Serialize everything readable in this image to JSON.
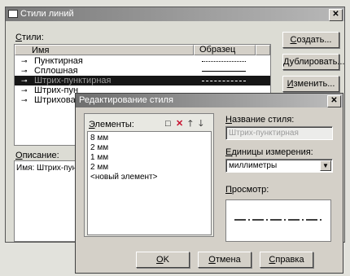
{
  "back_window": {
    "title": "Стили линий",
    "styles_label": "Стили:",
    "col_name": "Имя",
    "col_sample": "Образец",
    "rows": [
      {
        "name": "Пунктирная",
        "sample": "dotted"
      },
      {
        "name": "Сплошная",
        "sample": "solid"
      },
      {
        "name": "Штрих-пунктирная",
        "sample": "dashdot",
        "selected": true
      },
      {
        "name": "Штрих-пун",
        "sample": ""
      },
      {
        "name": "Штрихова",
        "sample": ""
      }
    ],
    "buttons": {
      "create": "Создать...",
      "duplicate": "Дублировать...",
      "edit": "Изменить..."
    },
    "description_label": "Описание:",
    "description_value": "Имя: Штрих-пун"
  },
  "dialog": {
    "title": "Редактирование стиля",
    "elements_label": "Элементы:",
    "toolbar_icons": [
      "new-icon",
      "delete-icon",
      "move-up-icon",
      "move-down-icon"
    ],
    "elements": [
      "8 мм",
      "2 мм",
      "1 мм",
      "2 мм",
      "<новый элемент>"
    ],
    "style_name_label": "Название стиля:",
    "style_name_value": "Штрих-пунктирная",
    "units_label": "Единицы измерения:",
    "units_value": "миллиметры",
    "preview_label": "Просмотр:",
    "buttons": {
      "ok": "OK",
      "cancel": "Отмена",
      "help": "Справка"
    }
  }
}
